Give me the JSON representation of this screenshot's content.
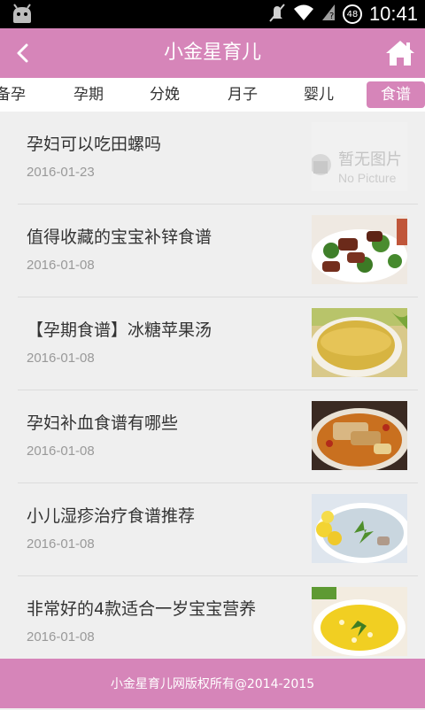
{
  "status_bar": {
    "time": "10:41",
    "battery": "48",
    "icons": [
      "android-icon",
      "mute-icon",
      "wifi-icon",
      "no-signal-icon",
      "battery-icon"
    ]
  },
  "header": {
    "title": "小金星育儿",
    "back_icon": "chevron-left-icon",
    "home_icon": "home-icon"
  },
  "tabs": [
    {
      "label": "备孕",
      "active": false
    },
    {
      "label": "孕期",
      "active": false
    },
    {
      "label": "分娩",
      "active": false
    },
    {
      "label": "月子",
      "active": false
    },
    {
      "label": "婴儿",
      "active": false
    },
    {
      "label": "食谱",
      "active": true
    }
  ],
  "articles": [
    {
      "title": "孕妇可以吃田螺吗",
      "date": "2016-01-23",
      "thumb": "placeholder",
      "thumb_text": "暂无图片",
      "thumb_text_en": "No Picture"
    },
    {
      "title": "值得收藏的宝宝补锌食谱",
      "date": "2016-01-08",
      "thumb": "stir-fry-dish"
    },
    {
      "title": "【孕期食谱】冰糖苹果汤",
      "date": "2016-01-08",
      "thumb": "soup-bowl"
    },
    {
      "title": "孕妇补血食谱有哪些",
      "date": "2016-01-08",
      "thumb": "braised-dish"
    },
    {
      "title": "小儿湿疹治疗食谱推荐",
      "date": "2016-01-08",
      "thumb": "corn-soup"
    },
    {
      "title": "非常好的4款适合一岁宝宝营养",
      "date": "2016-01-08",
      "thumb": "egg-corn-soup"
    }
  ],
  "footer": {
    "text": "小金星育儿网版权所有@2014-2015"
  },
  "colors": {
    "brand": "#d685b9",
    "background": "#efefef",
    "text": "#333333",
    "date": "#999999"
  }
}
